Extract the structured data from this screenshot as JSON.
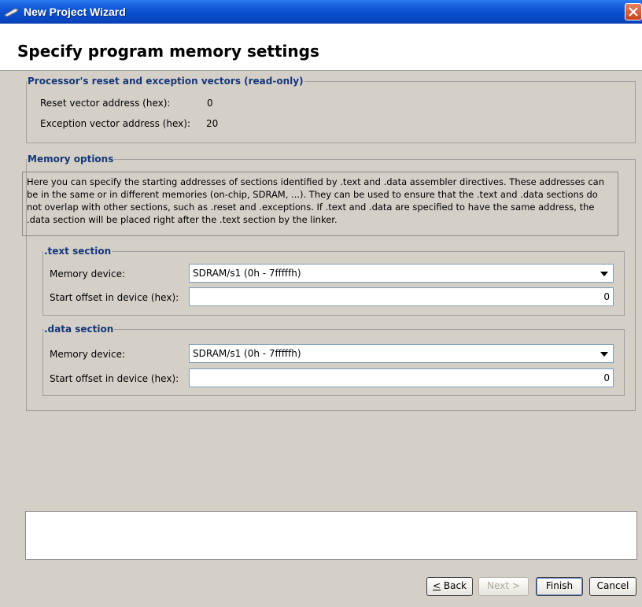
{
  "window": {
    "title": "New Project Wizard",
    "close_icon": "close-icon",
    "app_icon": "wand-icon"
  },
  "page": {
    "title": "Specify program memory settings"
  },
  "vectors": {
    "legend": "Processor's reset and exception vectors (read-only)",
    "reset_label": "Reset vector address (hex):",
    "reset_value": "0",
    "exception_label": "Exception vector address (hex):",
    "exception_value": "20"
  },
  "memory_options": {
    "legend": "Memory options",
    "description": "Here you can specify the starting addresses of sections identified by .text and .data assembler directives. These addresses can be in the same or in different memories (on-chip, SDRAM, ...). They can be used to ensure that the .text and .data sections do not overlap with other sections, such as .reset and .exceptions. If .text and .data are specified to have the same address, the .data section will be placed right after the .text section by the linker.",
    "text_section": {
      "legend": ".text section",
      "device_label": "Memory device:",
      "device_value": "SDRAM/s1 (0h - 7fffffh)",
      "offset_label": "Start offset in device (hex):",
      "offset_value": "0"
    },
    "data_section": {
      "legend": ".data section",
      "device_label": "Memory device:",
      "device_value": "SDRAM/s1 (0h - 7fffffh)",
      "offset_label": "Start offset in device (hex):",
      "offset_value": "0"
    }
  },
  "buttons": {
    "back": "< Back",
    "next": "Next >",
    "finish": "Finish",
    "cancel": "Cancel"
  }
}
